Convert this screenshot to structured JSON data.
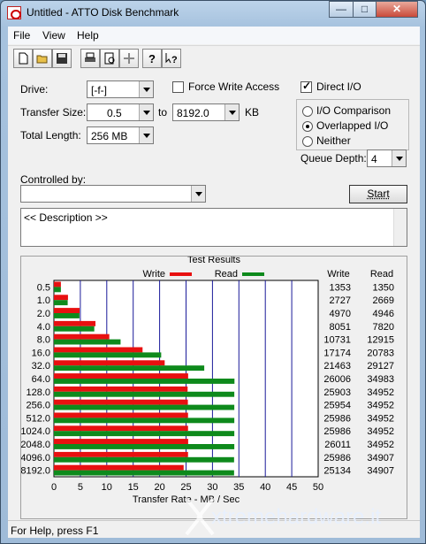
{
  "window": {
    "title": "Untitled - ATTO Disk Benchmark"
  },
  "menu": [
    "File",
    "View",
    "Help"
  ],
  "toolbar_icons": [
    "new-file-icon",
    "open-folder-icon",
    "save-icon",
    "print-icon",
    "print-preview-icon",
    "move-icon",
    "help-icon",
    "context-help-icon"
  ],
  "settings": {
    "drive_label": "Drive:",
    "drive_value": "[-f-]",
    "force_write_label": "Force Write Access",
    "direct_io_label": "Direct I/O",
    "transfer_size_label": "Transfer Size:",
    "transfer_from": "0.5",
    "to_label": "to",
    "transfer_to": "8192.0",
    "kb_label": "KB",
    "total_length_label": "Total Length:",
    "total_length_value": "256 MB",
    "io_comparison_label": "I/O Comparison",
    "overlapped_io_label": "Overlapped I/O",
    "neither_label": "Neither",
    "queue_depth_label": "Queue Depth:",
    "queue_depth_value": "4",
    "controlled_by_label": "Controlled by:",
    "controlled_by_value": "",
    "start_label": "Start",
    "description": "<< Description >>"
  },
  "results": {
    "group_title": "Test Results",
    "legend_write": "Write",
    "legend_read": "Read",
    "col_write": "Write",
    "col_read": "Read",
    "axis_label": "Transfer Rate - MB / Sec",
    "colors": {
      "write": "#e81010",
      "read": "#0e8a1c",
      "grid": "#1a1a9a"
    }
  },
  "chart_data": {
    "type": "bar",
    "categories": [
      "0.5",
      "1.0",
      "2.0",
      "4.0",
      "8.0",
      "16.0",
      "32.0",
      "64.0",
      "128.0",
      "256.0",
      "512.0",
      "1024.0",
      "2048.0",
      "4096.0",
      "8192.0"
    ],
    "series": [
      {
        "name": "Write",
        "values": [
          1353,
          2727,
          4970,
          8051,
          10731,
          17174,
          21463,
          26006,
          25903,
          25954,
          25986,
          25986,
          26011,
          25986,
          25134
        ]
      },
      {
        "name": "Read",
        "values": [
          1350,
          2669,
          4946,
          7820,
          12915,
          20783,
          29127,
          34983,
          34952,
          34952,
          34952,
          34952,
          34952,
          34907,
          34907
        ]
      }
    ],
    "xlabel": "Transfer Rate - MB / Sec",
    "xticks": [
      "0",
      "5",
      "10",
      "15",
      "20",
      "25",
      "30",
      "35",
      "40",
      "45",
      "50"
    ],
    "xlim": [
      0,
      50
    ],
    "grid": true,
    "legend": "top"
  },
  "status": {
    "text": "For Help, press F1"
  },
  "watermark": "xtremehardware.it"
}
